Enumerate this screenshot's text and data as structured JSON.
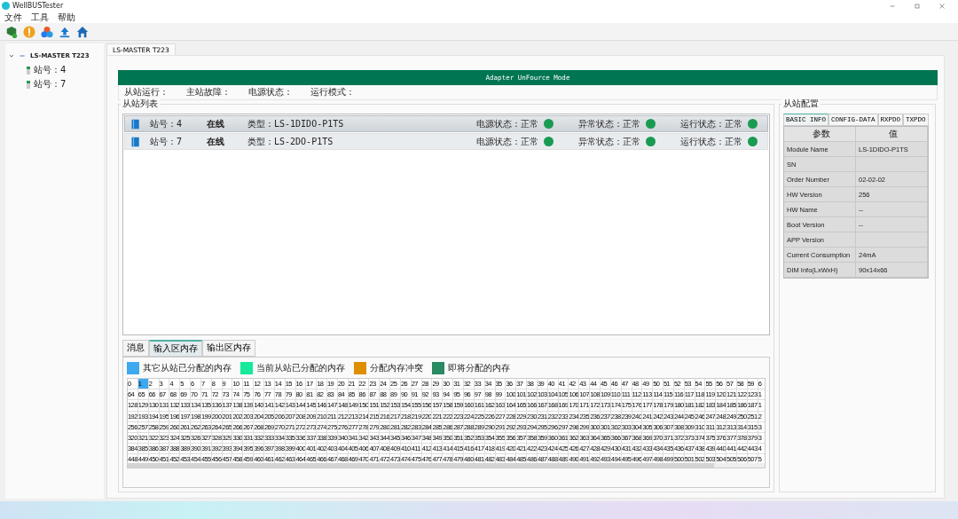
{
  "window": {
    "title": "WellBUSTester"
  },
  "menu": [
    "文件",
    "工具",
    "帮助"
  ],
  "tree": {
    "label": "LS-MASTER T223",
    "expanded": true,
    "children": [
      {
        "label": "站号：4"
      },
      {
        "label": "站号：7"
      }
    ]
  },
  "doc_tab": "LS-MASTER T223",
  "mode_banner": "Adapter UnFource Mode",
  "status_fields": [
    "从站运行：",
    "主站故障：",
    "电源状态：",
    "运行模式："
  ],
  "slave_list": {
    "title": "从站列表",
    "rows": [
      {
        "station": "站号：4",
        "online": "在线",
        "type": "类型：LS-1DIDO-P1TS",
        "selected": true,
        "status": [
          {
            "label": "电源状态：正常",
            "color": "#1a9b52"
          },
          {
            "label": "异常状态：正常",
            "color": "#1a9b52"
          },
          {
            "label": "运行状态：正常",
            "color": "#1a9b52"
          }
        ]
      },
      {
        "station": "站号：7",
        "online": "在线",
        "type": "类型：LS-2DO-P1TS",
        "selected": false,
        "status": [
          {
            "label": "电源状态：正常",
            "color": "#1a9b52"
          },
          {
            "label": "异常状态：正常",
            "color": "#1a9b52"
          },
          {
            "label": "运行状态：正常",
            "color": "#1a9b52"
          }
        ]
      }
    ]
  },
  "bottom_tabs": [
    {
      "label": "消息",
      "selected": false
    },
    {
      "label": "输入区内存",
      "selected": true
    },
    {
      "label": "输出区内存",
      "selected": false
    }
  ],
  "legend": [
    {
      "label": "其它从站已分配的内存",
      "color": "#3fa9ef"
    },
    {
      "label": "当前从站已分配的内存",
      "color": "#17ea9a"
    },
    {
      "label": "分配内存冲突",
      "color": "#de8f00"
    },
    {
      "label": "即将分配的内存",
      "color": "#2a8a61"
    }
  ],
  "memory_rows": [
    [
      "0",
      {
        "text": "1",
        "color": "#3fa9ef"
      },
      "2",
      "3",
      "4",
      "5",
      "6",
      "7",
      "8",
      "9",
      "10",
      "11",
      "12",
      "13",
      "14",
      "15",
      "16",
      "17",
      "18",
      "19",
      "20",
      "21",
      "22",
      "23",
      "24",
      "25",
      "26",
      "27",
      "28",
      "29",
      "30",
      "31",
      "32",
      "33",
      "34",
      "35",
      "36",
      "37",
      "38",
      "39",
      "40",
      "41",
      "42",
      "43",
      "44",
      "45",
      "46",
      "47",
      "48",
      "49",
      "50",
      "51",
      "52",
      "53",
      "54",
      "55",
      "56",
      "57",
      "58",
      "59",
      "6"
    ],
    [
      "64",
      "65",
      "66",
      "67",
      "68",
      "69",
      "70",
      "71",
      "72",
      "73",
      "74",
      "75",
      "76",
      "77",
      "78",
      "79",
      "80",
      "81",
      "82",
      "83",
      "84",
      "85",
      "86",
      "87",
      "88",
      "89",
      "90",
      "91",
      "92",
      "93",
      "94",
      "95",
      "96",
      "97",
      "98",
      "99",
      "100",
      "101",
      "102",
      "103",
      "104",
      "105",
      "106",
      "107",
      "108",
      "109",
      "110",
      "111",
      "112",
      "113",
      "114",
      "115",
      "116",
      "117",
      "118",
      "119",
      "120",
      "121",
      "122",
      "123",
      "1"
    ],
    [
      "128",
      "129",
      "130",
      "131",
      "132",
      "133",
      "134",
      "135",
      "136",
      "137",
      "138",
      "139",
      "140",
      "141",
      "142",
      "143",
      "144",
      "145",
      "146",
      "147",
      "148",
      "149",
      "150",
      "151",
      "152",
      "153",
      "154",
      "155",
      "156",
      "157",
      "158",
      "159",
      "160",
      "161",
      "162",
      "163",
      "164",
      "165",
      "166",
      "167",
      "168",
      "169",
      "170",
      "171",
      "172",
      "173",
      "174",
      "175",
      "176",
      "177",
      "178",
      "179",
      "180",
      "181",
      "182",
      "183",
      "184",
      "185",
      "186",
      "187",
      "1"
    ],
    [
      "192",
      "193",
      "194",
      "195",
      "196",
      "197",
      "198",
      "199",
      "200",
      "201",
      "202",
      "203",
      "204",
      "205",
      "206",
      "207",
      "208",
      "209",
      "210",
      "211",
      "212",
      "213",
      "214",
      "215",
      "216",
      "217",
      "218",
      "219",
      "220",
      "221",
      "222",
      "223",
      "224",
      "225",
      "226",
      "227",
      "228",
      "229",
      "230",
      "231",
      "232",
      "233",
      "234",
      "235",
      "236",
      "237",
      "238",
      "239",
      "240",
      "241",
      "242",
      "243",
      "244",
      "245",
      "246",
      "247",
      "248",
      "249",
      "250",
      "251",
      "2"
    ],
    [
      "256",
      "257",
      "258",
      "259",
      "260",
      "261",
      "262",
      "263",
      "264",
      "265",
      "266",
      "267",
      "268",
      "269",
      "270",
      "271",
      "272",
      "273",
      "274",
      "275",
      "276",
      "277",
      "278",
      "279",
      "280",
      "281",
      "282",
      "283",
      "284",
      "285",
      "286",
      "287",
      "288",
      "289",
      "290",
      "291",
      "292",
      "293",
      "294",
      "295",
      "296",
      "297",
      "298",
      "299",
      "300",
      "301",
      "302",
      "303",
      "304",
      "305",
      "306",
      "307",
      "308",
      "309",
      "310",
      "311",
      "312",
      "313",
      "314",
      "315",
      "3"
    ],
    [
      "320",
      "321",
      "322",
      "323",
      "324",
      "325",
      "326",
      "327",
      "328",
      "329",
      "330",
      "331",
      "332",
      "333",
      "334",
      "335",
      "336",
      "337",
      "338",
      "339",
      "340",
      "341",
      "342",
      "343",
      "344",
      "345",
      "346",
      "347",
      "348",
      "349",
      "350",
      "351",
      "352",
      "353",
      "354",
      "355",
      "356",
      "357",
      "358",
      "359",
      "360",
      "361",
      "362",
      "363",
      "364",
      "365",
      "366",
      "367",
      "368",
      "369",
      "370",
      "371",
      "372",
      "373",
      "374",
      "375",
      "376",
      "377",
      "378",
      "379",
      "3"
    ],
    [
      "384",
      "385",
      "386",
      "387",
      "388",
      "389",
      "390",
      "391",
      "392",
      "393",
      "394",
      "395",
      "396",
      "397",
      "398",
      "399",
      "400",
      "401",
      "402",
      "403",
      "404",
      "405",
      "406",
      "407",
      "408",
      "409",
      "410",
      "411",
      "412",
      "413",
      "414",
      "415",
      "416",
      "417",
      "418",
      "419",
      "420",
      "421",
      "422",
      "423",
      "424",
      "425",
      "426",
      "427",
      "428",
      "429",
      "430",
      "431",
      "432",
      "433",
      "434",
      "435",
      "436",
      "437",
      "438",
      "439",
      "440",
      "441",
      "442",
      "443",
      "4"
    ],
    [
      "448",
      "449",
      "450",
      "451",
      "452",
      "453",
      "454",
      "455",
      "456",
      "457",
      "458",
      "459",
      "460",
      "461",
      "462",
      "463",
      "464",
      "465",
      "466",
      "467",
      "468",
      "469",
      "470",
      "471",
      "472",
      "473",
      "474",
      "475",
      "476",
      "477",
      "478",
      "479",
      "480",
      "481",
      "482",
      "483",
      "484",
      "485",
      "486",
      "487",
      "488",
      "489",
      "490",
      "491",
      "492",
      "493",
      "494",
      "495",
      "496",
      "497",
      "498",
      "499",
      "500",
      "501",
      "502",
      "503",
      "504",
      "505",
      "506",
      "507",
      "5"
    ]
  ],
  "config": {
    "title": "从站配置",
    "tabs": [
      {
        "label": "BASIC INFO",
        "selected": true
      },
      {
        "label": "CONFIG-DATA",
        "selected": false
      },
      {
        "label": "RXPDO",
        "selected": false
      },
      {
        "label": "TXPDO",
        "selected": false
      }
    ],
    "columns": [
      "参数",
      "值"
    ],
    "rows": [
      [
        "Module Name",
        "LS-1DIDO-P1TS"
      ],
      [
        "SN",
        ""
      ],
      [
        "Order Number",
        "02-02-02"
      ],
      [
        "HW Version",
        "256"
      ],
      [
        "HW Name",
        "--"
      ],
      [
        "Boot Version",
        "--"
      ],
      [
        "APP Version",
        ""
      ],
      [
        "Current Consumption",
        "24mA"
      ],
      [
        "DIM Info(LxWxH)",
        "90x14x66"
      ]
    ]
  }
}
